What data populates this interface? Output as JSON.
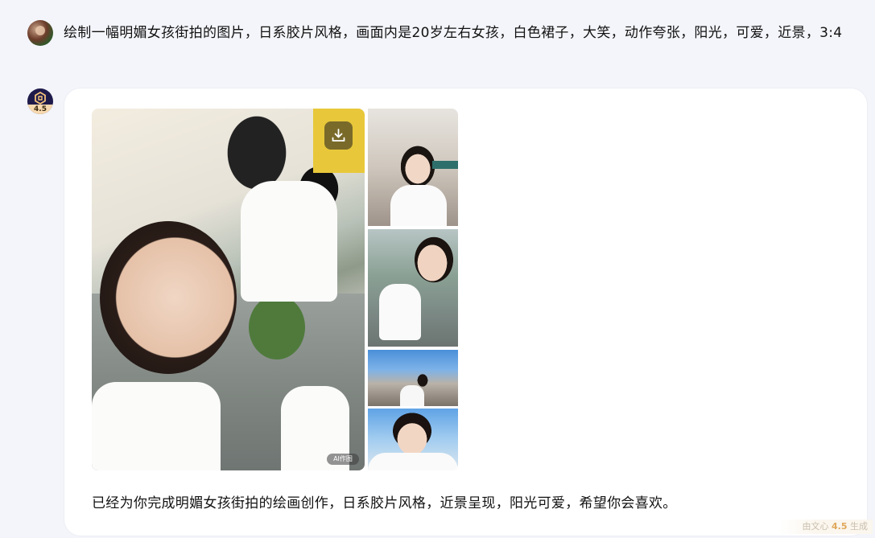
{
  "user_message": {
    "text": "绘制一幅明媚女孩街拍的图片，日系胶片风格，画面内是20岁左右女孩，白色裙子，大笑，动作夸张，阳光，可爱，近景，3:4"
  },
  "bot": {
    "avatar_version": "4.5",
    "gallery": {
      "ai_badge": "AI作图",
      "download_icon": "download-icon"
    },
    "reply_text": "已经为你完成明媚女孩街拍的绘画创作，日系胶片风格，近景呈现，阳光可爱，希望你会喜欢。"
  },
  "footer": {
    "generated_prefix": "由文心",
    "generated_version": "4.5",
    "generated_suffix": "生成"
  },
  "colors": {
    "page_bg": "#f4f5fa",
    "bubble_bg": "#ffffff",
    "bot_avatar_bg": "#1e1b4b"
  }
}
